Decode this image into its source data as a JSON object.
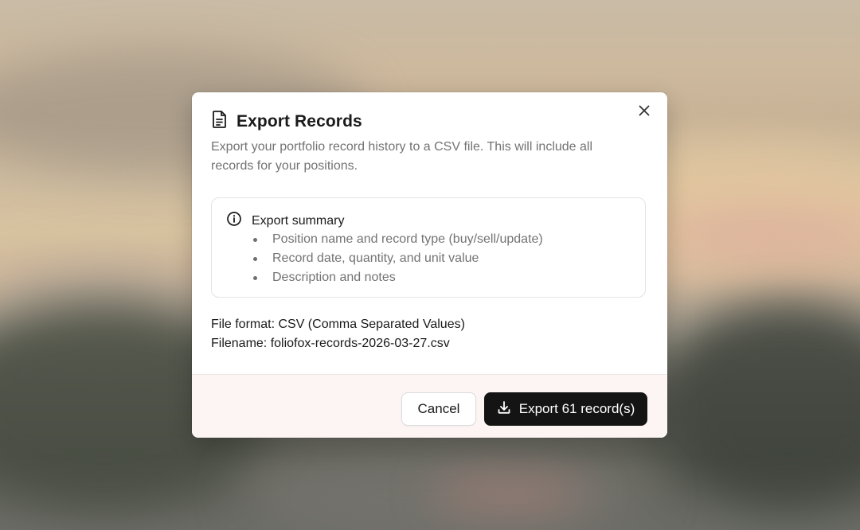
{
  "dialog": {
    "title": "Export Records",
    "description": "Export your portfolio record history to a CSV file. This will include all records for your positions.",
    "title_icon": "document-icon",
    "close_icon": "close-icon"
  },
  "summary": {
    "icon": "info-icon",
    "title": "Export summary",
    "items": [
      "Position name and record type (buy/sell/update)",
      "Record date, quantity, and unit value",
      "Description and notes"
    ]
  },
  "file": {
    "format_line": "File format: CSV (Comma Separated Values)",
    "filename_line": "Filename: foliofox-records-2026-03-27.csv"
  },
  "footer": {
    "cancel_label": "Cancel",
    "export_label": "Export 61 record(s)",
    "export_icon": "download-icon"
  },
  "colors": {
    "primary_button": "#141414",
    "footer_bg": "#fdf5f4",
    "muted_text": "#737373"
  }
}
